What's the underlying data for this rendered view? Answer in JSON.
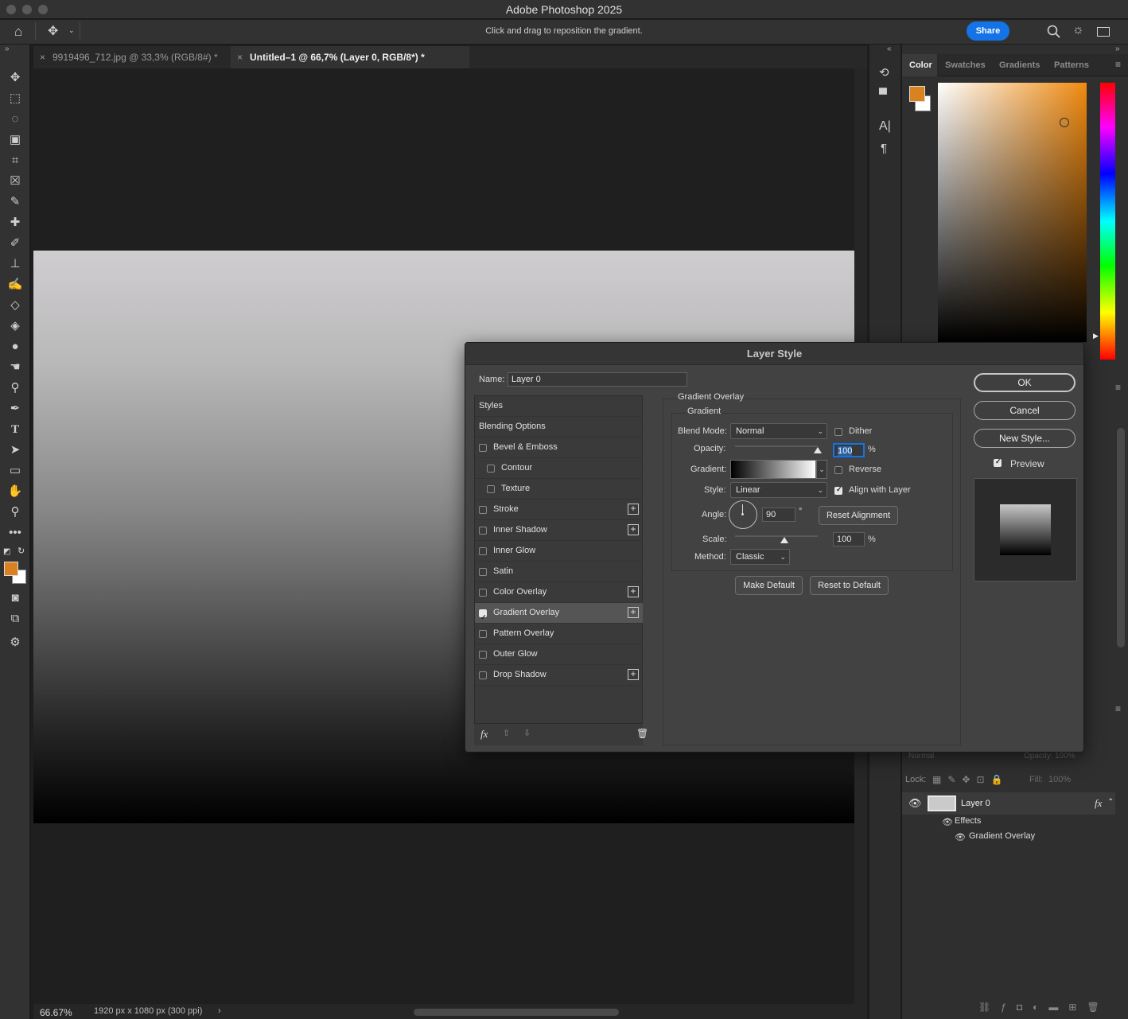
{
  "app": {
    "title": "Adobe Photoshop 2025",
    "hint": "Click and drag to reposition the gradient.",
    "share_label": "Share"
  },
  "tabs": [
    {
      "label": "9919496_712.jpg @ 33,3% (RGB/8#) *"
    },
    {
      "label": "Untitled–1 @ 66,7% (Layer 0, RGB/8*) *"
    }
  ],
  "status": {
    "zoom": "66.67%",
    "doc_info": "1920 px x 1080 px (300 ppi)"
  },
  "color_panel": {
    "tabs": [
      "Color",
      "Swatches",
      "Gradients",
      "Patterns"
    ],
    "foreground": "#d9821f",
    "background": "#ffffff"
  },
  "layers": {
    "blend_mode": "Normal",
    "opacity_label": "Opacity:",
    "opacity": "100%",
    "lock_label": "Lock:",
    "fill_label": "Fill:",
    "fill": "100%",
    "layer_name": "Layer 0",
    "effects_label": "Effects",
    "effect_name": "Gradient Overlay"
  },
  "dialog": {
    "title": "Layer Style",
    "name_label": "Name:",
    "name_value": "Layer 0",
    "styles": [
      {
        "label": "Styles",
        "checkbox": false,
        "checked": false,
        "plus": false,
        "indent": 0,
        "selected": false
      },
      {
        "label": "Blending Options",
        "checkbox": false,
        "checked": false,
        "plus": false,
        "indent": 0,
        "selected": false
      },
      {
        "label": "Bevel & Emboss",
        "checkbox": true,
        "checked": false,
        "plus": false,
        "indent": 0,
        "selected": false
      },
      {
        "label": "Contour",
        "checkbox": true,
        "checked": false,
        "plus": false,
        "indent": 1,
        "selected": false
      },
      {
        "label": "Texture",
        "checkbox": true,
        "checked": false,
        "plus": false,
        "indent": 1,
        "selected": false
      },
      {
        "label": "Stroke",
        "checkbox": true,
        "checked": false,
        "plus": true,
        "indent": 0,
        "selected": false
      },
      {
        "label": "Inner Shadow",
        "checkbox": true,
        "checked": false,
        "plus": true,
        "indent": 0,
        "selected": false
      },
      {
        "label": "Inner Glow",
        "checkbox": true,
        "checked": false,
        "plus": false,
        "indent": 0,
        "selected": false
      },
      {
        "label": "Satin",
        "checkbox": true,
        "checked": false,
        "plus": false,
        "indent": 0,
        "selected": false
      },
      {
        "label": "Color Overlay",
        "checkbox": true,
        "checked": false,
        "plus": true,
        "indent": 0,
        "selected": false
      },
      {
        "label": "Gradient Overlay",
        "checkbox": true,
        "checked": true,
        "plus": true,
        "indent": 0,
        "selected": true
      },
      {
        "label": "Pattern Overlay",
        "checkbox": true,
        "checked": false,
        "plus": false,
        "indent": 0,
        "selected": false
      },
      {
        "label": "Outer Glow",
        "checkbox": true,
        "checked": false,
        "plus": false,
        "indent": 0,
        "selected": false
      },
      {
        "label": "Drop Shadow",
        "checkbox": true,
        "checked": false,
        "plus": true,
        "indent": 0,
        "selected": false
      }
    ],
    "section_title": "Gradient Overlay",
    "subsection": "Gradient",
    "blend_mode_label": "Blend Mode:",
    "blend_mode": "Normal",
    "dither_label": "Dither",
    "dither_checked": false,
    "opacity_label": "Opacity:",
    "opacity": "100",
    "opacity_level": 1.0,
    "percent": "%",
    "gradient_label": "Gradient:",
    "reverse_label": "Reverse",
    "reverse_checked": false,
    "style_label": "Style:",
    "style": "Linear",
    "align_label": "Align with Layer",
    "align_checked": true,
    "angle_label": "Angle:",
    "angle": "90",
    "degree": "°",
    "reset_alignment_label": "Reset Alignment",
    "scale_label": "Scale:",
    "scale": "100",
    "scale_level": 0.6,
    "method_label": "Method:",
    "method": "Classic",
    "make_default_label": "Make Default",
    "reset_default_label": "Reset to Default",
    "ok_label": "OK",
    "cancel_label": "Cancel",
    "new_style_label": "New Style...",
    "preview_label": "Preview",
    "preview_checked": true
  }
}
